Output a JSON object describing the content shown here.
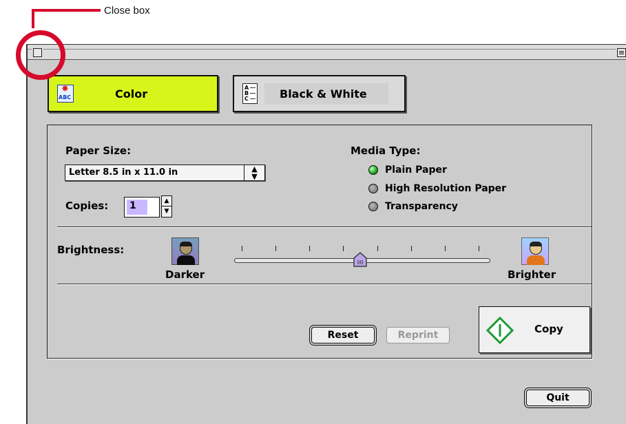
{
  "annotation": {
    "label": "Close box"
  },
  "window": {
    "mode_tabs": [
      {
        "label": "Color",
        "selected": true,
        "icon": "color-abc-icon"
      },
      {
        "label": "Black & White",
        "selected": false,
        "icon": "bw-abc-icon"
      }
    ],
    "bw_icon_letters": [
      "A",
      "B",
      "C"
    ],
    "color_icon_letters": "ABC",
    "paper_size": {
      "label": "Paper Size:",
      "value": "Letter 8.5 in x 11.0 in"
    },
    "copies": {
      "label": "Copies:",
      "value": "1"
    },
    "media_type": {
      "label": "Media Type:",
      "options": [
        {
          "label": "Plain Paper",
          "selected": true
        },
        {
          "label": "High Resolution Paper",
          "selected": false
        },
        {
          "label": "Transparency",
          "selected": false
        }
      ]
    },
    "brightness": {
      "label": "Brightness:",
      "min_label": "Darker",
      "max_label": "Brighter",
      "ticks": 8,
      "level": 0.5
    },
    "buttons": {
      "reset": "Reset",
      "reprint": "Reprint",
      "copy": "Copy",
      "quit": "Quit"
    },
    "colors": {
      "accent": "#d7f51a",
      "radio_on": "#1fa51f",
      "copy_glyph": "#1e9a35",
      "annotation": "#d60a2c"
    }
  }
}
